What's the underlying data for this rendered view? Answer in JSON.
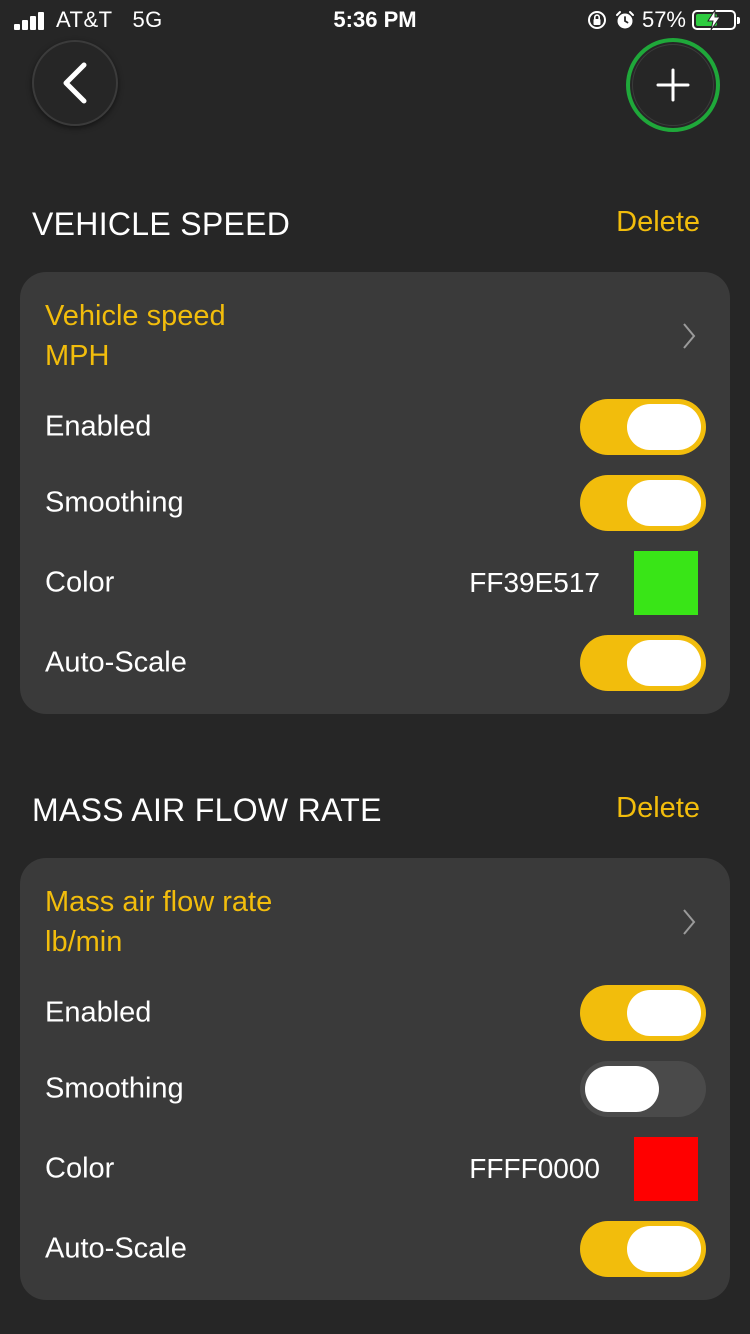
{
  "status_bar": {
    "carrier": "AT&T",
    "network": "5G",
    "time": "5:36 PM",
    "battery_percent": "57%",
    "battery_level": 0.57,
    "icons": [
      "signal-icon",
      "orientation-lock-icon",
      "alarm-icon",
      "battery-charging-icon"
    ]
  },
  "nav": {
    "back_icon": "chevron-left-icon",
    "add_icon": "plus-icon"
  },
  "sections": [
    {
      "title": "VEHICLE SPEED",
      "delete_label": "Delete",
      "sensor_name": "Vehicle speed",
      "sensor_unit": "MPH",
      "enabled_label": "Enabled",
      "enabled": true,
      "smoothing_label": "Smoothing",
      "smoothing": true,
      "color_label": "Color",
      "color_hex": "FF39E517",
      "swatch_color": "#39E517",
      "autoscale_label": "Auto-Scale",
      "autoscale": true
    },
    {
      "title": "MASS AIR FLOW RATE",
      "delete_label": "Delete",
      "sensor_name": "Mass air flow rate",
      "sensor_unit": "lb/min",
      "enabled_label": "Enabled",
      "enabled": true,
      "smoothing_label": "Smoothing",
      "smoothing": false,
      "color_label": "Color",
      "color_hex": "FFFF0000",
      "swatch_color": "#FF0000",
      "autoscale_label": "Auto-Scale",
      "autoscale": true
    }
  ],
  "colors": {
    "background": "#262626",
    "card": "#3a3a3a",
    "accent": "#F2BD0C",
    "toggle_off": "#4a4a4a",
    "add_ring": "#1FA83A"
  }
}
